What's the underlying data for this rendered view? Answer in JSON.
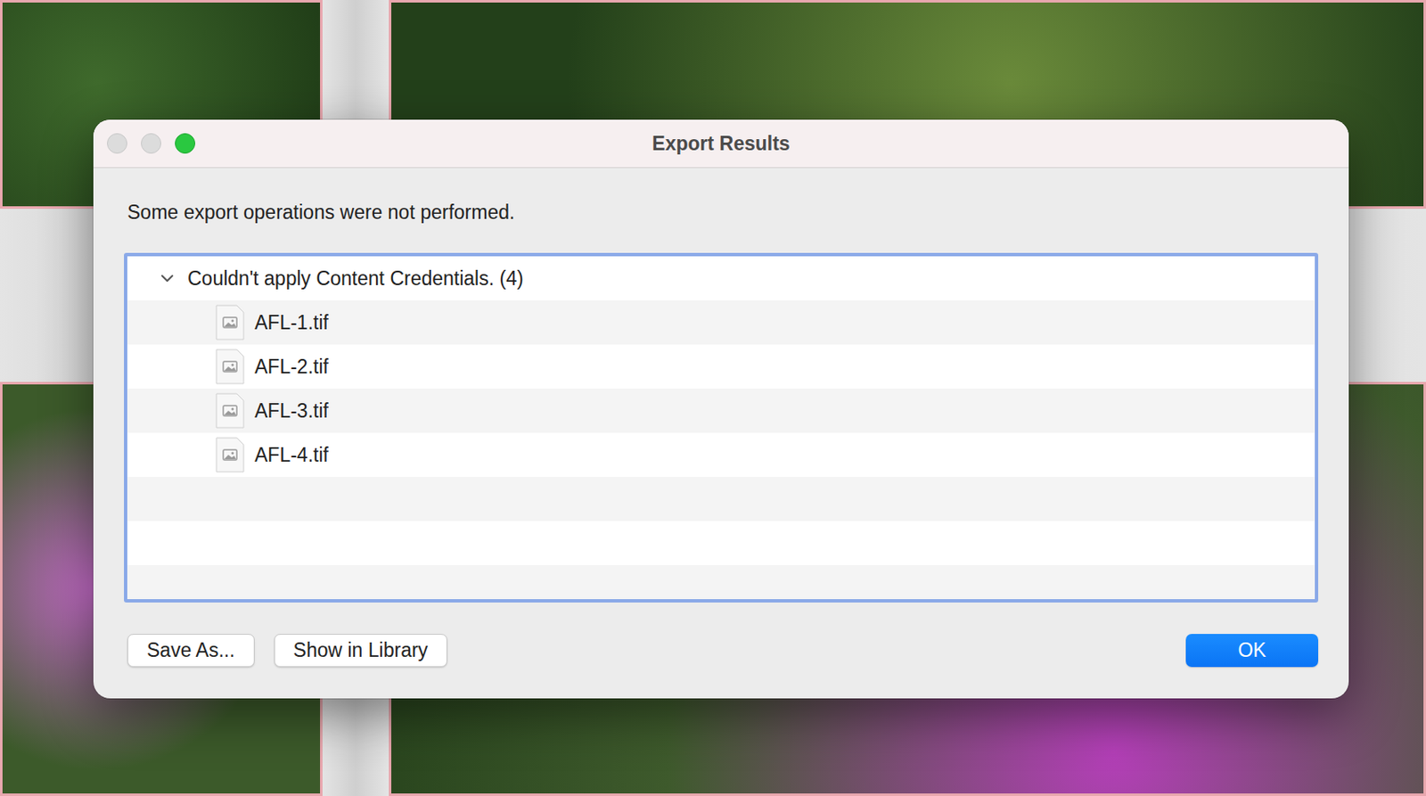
{
  "window": {
    "title": "Export Results"
  },
  "message": "Some export operations were not performed.",
  "group": {
    "label": "Couldn't apply Content Credentials. (4)",
    "expanded": true,
    "files": [
      {
        "name": "AFL-1.tif"
      },
      {
        "name": "AFL-2.tif"
      },
      {
        "name": "AFL-3.tif"
      },
      {
        "name": "AFL-4.tif"
      }
    ]
  },
  "buttons": [
    {
      "label": "Save As...",
      "default": false
    },
    {
      "label": "Show in Library",
      "default": false
    },
    {
      "label": "OK",
      "default": true
    }
  ]
}
